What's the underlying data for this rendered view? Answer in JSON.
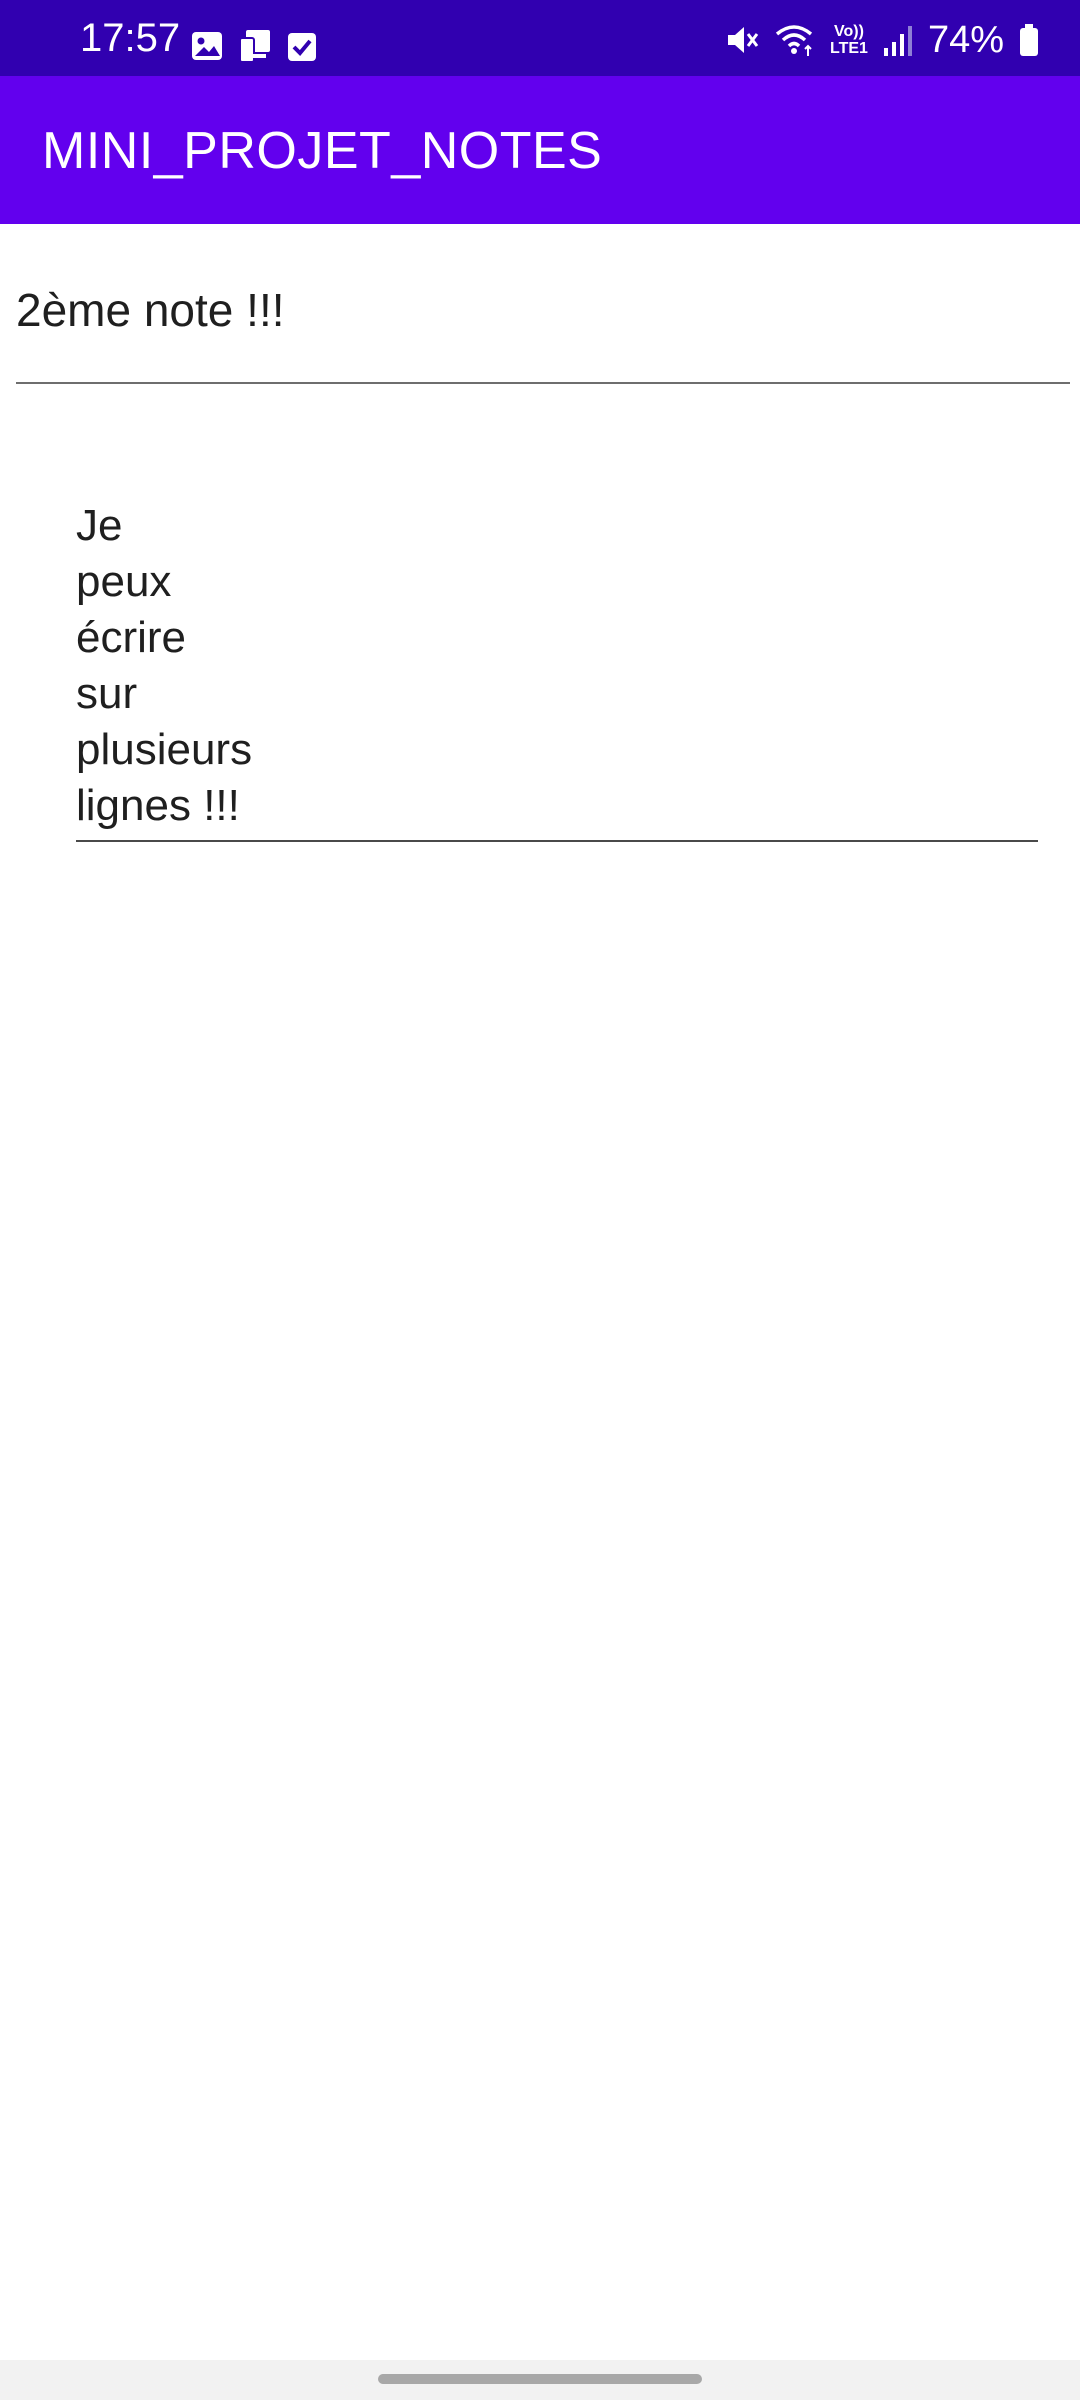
{
  "status_bar": {
    "time": "17:57",
    "battery": "74%",
    "left_icons": [
      "image-icon",
      "device-icon",
      "checkbox-icon"
    ],
    "right_icons": [
      "mute-icon",
      "wifi-icon",
      "volte-icon",
      "signal-icon",
      "battery-icon"
    ],
    "volte_top": "Vo))",
    "volte_bottom": "LTE1",
    "background_color": "#3100b0"
  },
  "app_bar": {
    "title": "MINI_PROJET_NOTES",
    "background_color": "#6200ee"
  },
  "note": {
    "title": "2ème note !!!",
    "content_lines": [
      "Je",
      "peux",
      "écrire",
      "sur",
      "plusieurs",
      "lignes !!!"
    ]
  }
}
